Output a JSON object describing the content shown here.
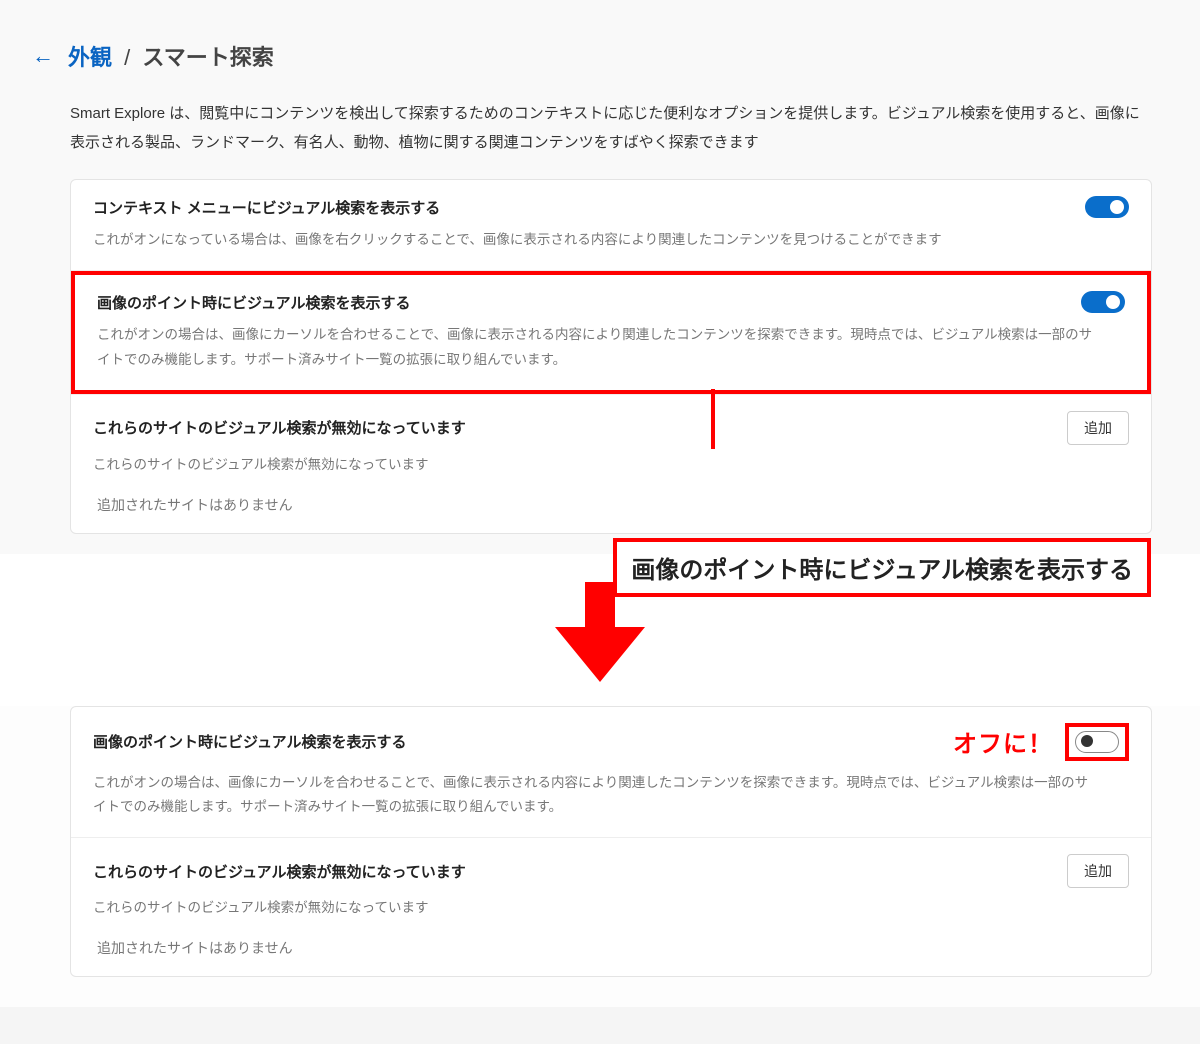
{
  "header": {
    "back_link": "外観",
    "separator": "/",
    "current": "スマート探索"
  },
  "intro": "Smart Explore は、閲覧中にコンテンツを検出して探索するためのコンテキストに応じた便利なオプションを提供します。ビジュアル検索を使用すると、画像に表示される製品、ランドマーク、有名人、動物、植物に関する関連コンテンツをすばやく探索できます",
  "row1": {
    "title": "コンテキスト メニューにビジュアル検索を表示する",
    "desc": "これがオンになっている場合は、画像を右クリックすることで、画像に表示される内容により関連したコンテンツを見つけることができます"
  },
  "row2": {
    "title": "画像のポイント時にビジュアル検索を表示する",
    "desc": "これがオンの場合は、画像にカーソルを合わせることで、画像に表示される内容により関連したコンテンツを探索できます。現時点では、ビジュアル検索は一部のサイトでのみ機能します。サポート済みサイト一覧の拡張に取り組んでいます。"
  },
  "row3": {
    "title": "これらのサイトのビジュアル検索が無効になっています",
    "desc": "これらのサイトのビジュアル検索が無効になっています",
    "empty": "追加されたサイトはありません",
    "add_btn": "追加"
  },
  "callout": "画像のポイント時にビジュアル検索を表示する",
  "off_label": "オフに！"
}
